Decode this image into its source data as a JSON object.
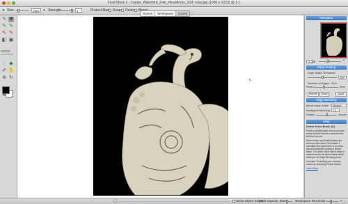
{
  "window": {
    "title": "Fluid Mask 3 - Copan_Waterbird_Fish_Headdress_DSF copy.jpg (1000 x 1333) @ 1:1"
  },
  "toolbar": {
    "size_label": "Size",
    "size_value": "15px",
    "strength_label": "Strength",
    "strength_value": "1",
    "protect_label": "Protect Mask:",
    "keep_label": "Keep",
    "delete_label": "Delete",
    "blend_label": "Blend"
  },
  "view_tabs": [
    {
      "label": "Source",
      "active": false
    },
    {
      "label": "Workspace",
      "active": false
    },
    {
      "label": "Cutout",
      "active": true
    }
  ],
  "tools": [
    {
      "icon": "brush-icon",
      "glyph": "✎",
      "color": "#2d8a2d"
    },
    {
      "icon": "move-icon",
      "glyph": "✥",
      "color": "#333333",
      "selected": true
    },
    {
      "icon": "keep-brush-icon",
      "glyph": "✎",
      "color": "#2d8a2d"
    },
    {
      "icon": "keep-local-icon",
      "glyph": "✎",
      "color": "#2d8a2d"
    },
    {
      "icon": "delete-brush-icon",
      "glyph": "✎",
      "color": "#c62828"
    },
    {
      "icon": "delete-local-icon",
      "glyph": "✎",
      "color": "#c62828"
    },
    {
      "icon": "eraser-icon",
      "glyph": "◧",
      "color": "#555555"
    },
    {
      "icon": "patch-icon",
      "glyph": "▣",
      "color": "#555555"
    },
    {
      "icon": "lasso-icon",
      "glyph": "◌",
      "color": "#555555"
    },
    {
      "icon": "fill-icon",
      "glyph": "◆",
      "color": "#2d8a2d"
    },
    {
      "icon": "eyedropper-icon",
      "glyph": "✐",
      "color": "#555555"
    },
    {
      "icon": "hand-icon",
      "glyph": "✋",
      "color": "#555555"
    },
    {
      "icon": "zoom-icon",
      "glyph": "⊕",
      "color": "#555555"
    },
    {
      "icon": "rotate-icon",
      "glyph": "↻",
      "color": "#555555"
    }
  ],
  "logo_text": [
    "vertus",
    "FLUID MASK"
  ],
  "navigator": {
    "header": "Navigator",
    "zoom_value": "19.766"
  },
  "edge_finding": {
    "header": "Edge Finding",
    "threshold_label": "Edge Width Threshold",
    "threshold_range": "Size",
    "num_edges_label": "Number of Edges",
    "num_edges_value": "23.6",
    "fewer_label": "Fewer",
    "more_label": "More",
    "refresh_label": "Refresh",
    "reset_label": "Reset",
    "apply_label": "Apply"
  },
  "edge_blending": {
    "header": "Edge Blending",
    "mode_label": "Blend Mask Width",
    "mode_value": "Medium",
    "intelligent_label": "Intelligent Blending",
    "intelligent_value": "1.0",
    "feather_label": "Feather",
    "smooth_label": "Smooth"
  },
  "help": {
    "header": "Help",
    "title": "Delete Exact Brush (D)",
    "p1": "Paints a Delete Mask area to process areas that will then be removed from the final cut-out.",
    "p2": "Where Keep and Delete Masks are close to each other, Fluid Mask 3 calculates the placement of an edge and automatically creates a Blend Mask. The width of this Blend Mask is determined by the Blend Mask Width setting in the Edge Blending panel.",
    "p3": "Consider: Protecting your existing masks by checking Protect Masks.",
    "link": "Learn More"
  },
  "status": {
    "show_object_edges": "Show Object Edges",
    "mask_opacity": "Mask Opacity: 50%",
    "workspace_resolution": "Workspace Resolution"
  }
}
